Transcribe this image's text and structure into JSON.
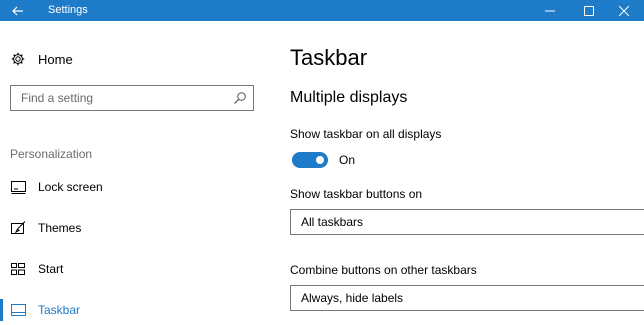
{
  "window": {
    "title": "Settings",
    "controls": [
      "minimize",
      "maximize",
      "close"
    ]
  },
  "sidebar": {
    "home_label": "Home",
    "search": {
      "placeholder": "Find a setting",
      "value": ""
    },
    "section_label": "Personalization",
    "items": [
      {
        "label": "Lock screen",
        "icon": "lock-screen-icon",
        "selected": false
      },
      {
        "label": "Themes",
        "icon": "themes-brush-icon",
        "selected": false
      },
      {
        "label": "Start",
        "icon": "start-icon",
        "selected": false
      },
      {
        "label": "Taskbar",
        "icon": "taskbar-icon",
        "selected": true
      }
    ]
  },
  "main": {
    "title": "Taskbar",
    "subtitle": "Multiple displays",
    "show_all_displays": {
      "label": "Show taskbar on all displays",
      "state": "On"
    },
    "show_buttons_on": {
      "label": "Show taskbar buttons on",
      "value": "All taskbars"
    },
    "combine_buttons": {
      "label": "Combine buttons on other taskbars",
      "value": "Always, hide labels"
    }
  },
  "colors": {
    "accent": "#1e7bc8",
    "titlebar": "#1e7bc8",
    "secondary_text": "#6b6b6b",
    "border": "#7a7a7a"
  }
}
